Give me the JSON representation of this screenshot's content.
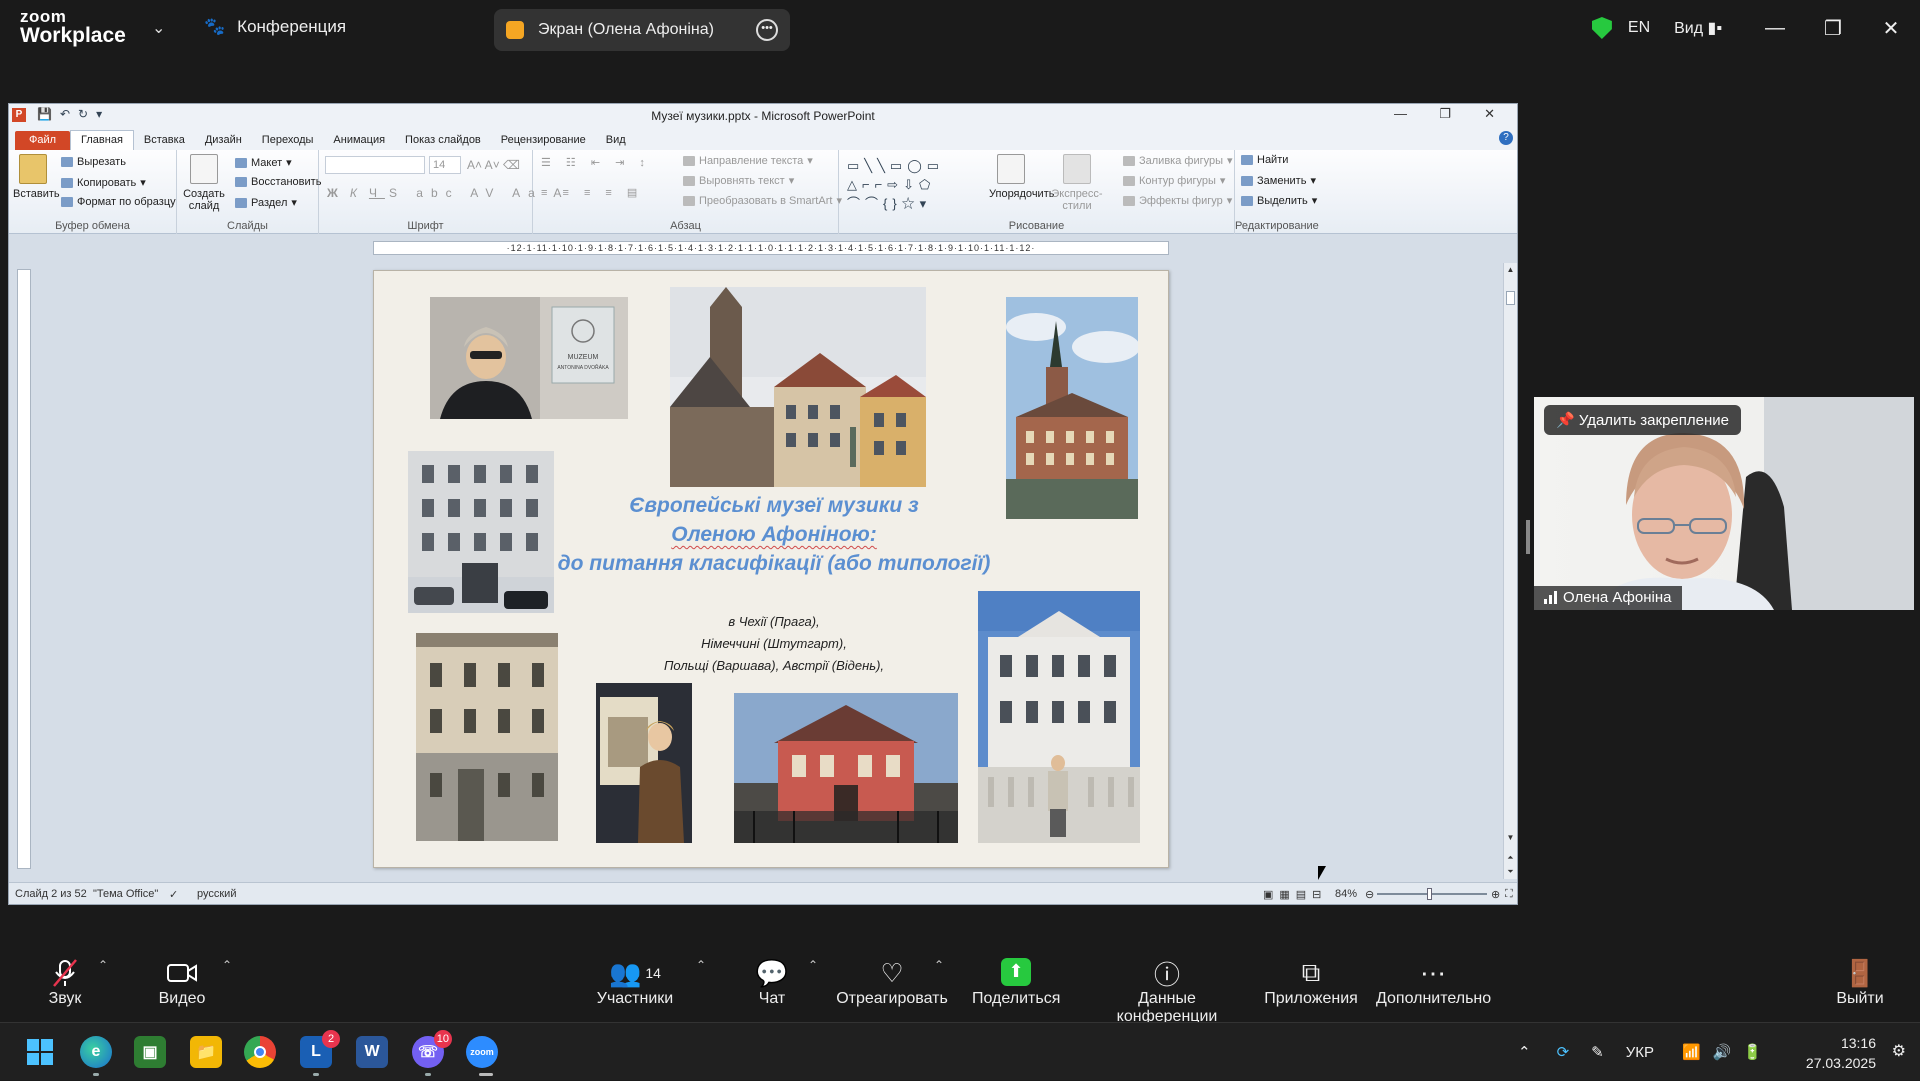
{
  "zoom": {
    "logo_line1": "zoom",
    "logo_line2": "Workplace",
    "conference_label": "Конференция",
    "share_title": "Экран (Олена Афоніна)",
    "lang": "EN",
    "view_label": "Вид",
    "bottom": {
      "audio": "Звук",
      "video": "Видео",
      "participants": "Участники",
      "participants_count": "14",
      "chat": "Чат",
      "react": "Отреагировать",
      "share": "Поделиться",
      "conf_info": "Данные конференции",
      "apps": "Приложения",
      "more": "Дополнительно",
      "leave": "Выйти"
    },
    "tile": {
      "unpin": "Удалить закрепление",
      "name": "Олена Афоніна"
    }
  },
  "ppt": {
    "title": "Музеї музики.pptx - Microsoft PowerPoint",
    "tabs": [
      "Файл",
      "Главная",
      "Вставка",
      "Дизайн",
      "Переходы",
      "Анимация",
      "Показ слайдов",
      "Рецензирование",
      "Вид"
    ],
    "active_tab": "Главная",
    "ribbon": {
      "clipboard": {
        "paste": "Вставить",
        "cut": "Вырезать",
        "copy": "Копировать",
        "format": "Формат по образцу",
        "name": "Буфер обмена"
      },
      "slides": {
        "new_slide": "Создать слайд",
        "layout": "Макет",
        "reset": "Восстановить",
        "section": "Раздел",
        "name": "Слайды"
      },
      "font": {
        "size": "14",
        "name": "Шрифт"
      },
      "paragraph": {
        "text_dir": "Направление текста",
        "align_text": "Выровнять текст",
        "smartart": "Преобразовать в SmartArt",
        "name": "Абзац"
      },
      "drawing": {
        "arrange": "Упорядочить",
        "quick_styles": "Экспресс-стили",
        "fill": "Заливка фигуры",
        "outline": "Контур фигуры",
        "effects": "Эффекты фигур",
        "name": "Рисование"
      },
      "editing": {
        "find": "Найти",
        "replace": "Заменить",
        "select": "Выделить",
        "name": "Редактирование"
      }
    },
    "ruler_text": "·12·1·11·1·10·1·9·1·8·1·7·1·6·1·5·1·4·1·3·1·2·1·1·1·0·1·1·1·2·1·3·1·4·1·5·1·6·1·7·1·8·1·9·1·10·1·11·1·12·",
    "slide": {
      "title_line1": "Європейські музеї музики з",
      "title_line2": "Оленою Афоніною:",
      "title_line3": "до питання класифікації (або типології)",
      "list_line1": "в Чехії (Прага),",
      "list_line2": "Німеччині (Штутгарт),",
      "list_line3": "Польщі (Варшава), Австрії (Відень),",
      "sign_line1": "MUZEUM",
      "sign_line2": "ANTONINA DVOŘÁKA"
    },
    "status": {
      "slide": "Слайд 2 из 52",
      "theme": "\"Тема Office\"",
      "lang": "русский",
      "zoom": "84%"
    }
  },
  "taskbar": {
    "lang": "УКР",
    "time": "13:16",
    "date": "27.03.2025",
    "lync_badge": "2",
    "viber_badge": "10"
  }
}
